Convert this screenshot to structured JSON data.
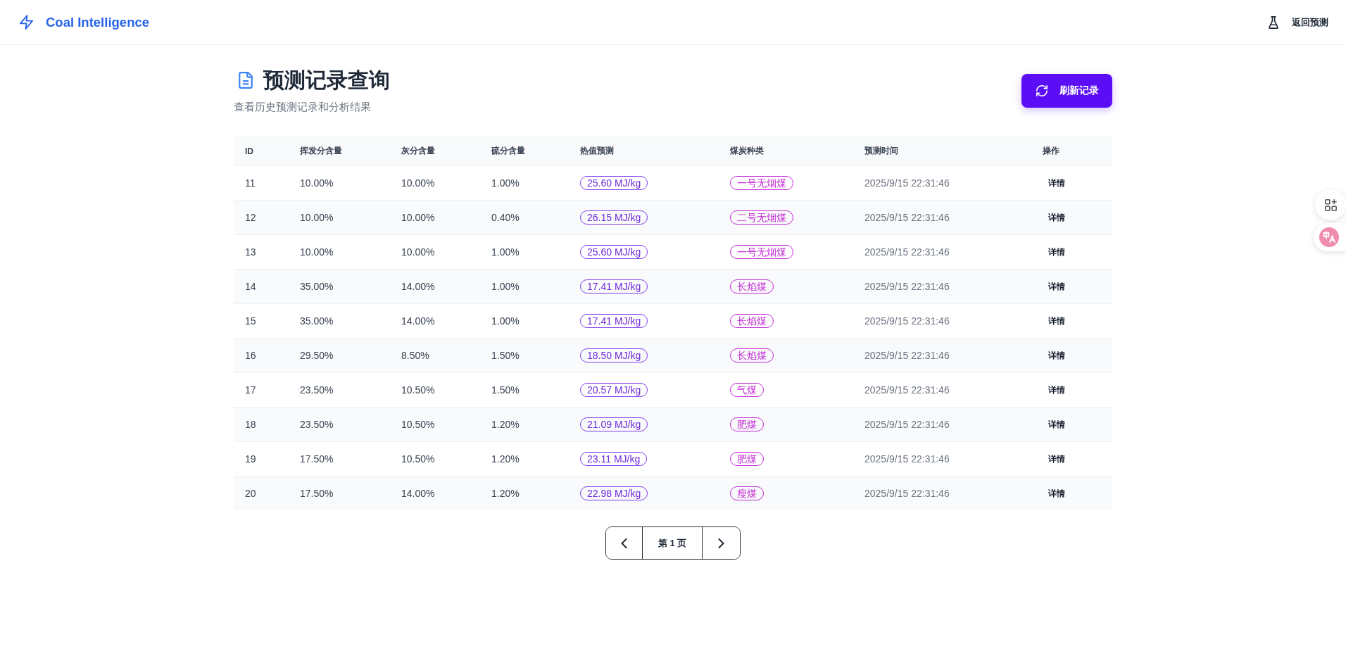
{
  "header": {
    "brand": "Coal Intelligence",
    "nav_link": "返回预测"
  },
  "page": {
    "title": "预测记录查询",
    "subtitle": "查看历史预测记录和分析结果",
    "refresh_button": "刷新记录"
  },
  "table": {
    "columns": [
      "ID",
      "挥发分含量",
      "灰分含量",
      "硫分含量",
      "热值预测",
      "煤炭种类",
      "预测时间",
      "操作"
    ],
    "rows": [
      {
        "id": "11",
        "volatile": "10.00%",
        "ash": "10.00%",
        "sulfur": "1.00%",
        "heat_value": "25.60 MJ/kg",
        "coal_type": "一号无烟煤",
        "time": "2025/9/15 22:31:46",
        "action": "详情"
      },
      {
        "id": "12",
        "volatile": "10.00%",
        "ash": "10.00%",
        "sulfur": "0.40%",
        "heat_value": "26.15 MJ/kg",
        "coal_type": "二号无烟煤",
        "time": "2025/9/15 22:31:46",
        "action": "详情"
      },
      {
        "id": "13",
        "volatile": "10.00%",
        "ash": "10.00%",
        "sulfur": "1.00%",
        "heat_value": "25.60 MJ/kg",
        "coal_type": "一号无烟煤",
        "time": "2025/9/15 22:31:46",
        "action": "详情"
      },
      {
        "id": "14",
        "volatile": "35.00%",
        "ash": "14.00%",
        "sulfur": "1.00%",
        "heat_value": "17.41 MJ/kg",
        "coal_type": "长焰煤",
        "time": "2025/9/15 22:31:46",
        "action": "详情"
      },
      {
        "id": "15",
        "volatile": "35.00%",
        "ash": "14.00%",
        "sulfur": "1.00%",
        "heat_value": "17.41 MJ/kg",
        "coal_type": "长焰煤",
        "time": "2025/9/15 22:31:46",
        "action": "详情"
      },
      {
        "id": "16",
        "volatile": "29.50%",
        "ash": "8.50%",
        "sulfur": "1.50%",
        "heat_value": "18.50 MJ/kg",
        "coal_type": "长焰煤",
        "time": "2025/9/15 22:31:46",
        "action": "详情"
      },
      {
        "id": "17",
        "volatile": "23.50%",
        "ash": "10.50%",
        "sulfur": "1.50%",
        "heat_value": "20.57 MJ/kg",
        "coal_type": "气煤",
        "time": "2025/9/15 22:31:46",
        "action": "详情"
      },
      {
        "id": "18",
        "volatile": "23.50%",
        "ash": "10.50%",
        "sulfur": "1.20%",
        "heat_value": "21.09 MJ/kg",
        "coal_type": "肥煤",
        "time": "2025/9/15 22:31:46",
        "action": "详情"
      },
      {
        "id": "19",
        "volatile": "17.50%",
        "ash": "10.50%",
        "sulfur": "1.20%",
        "heat_value": "23.11 MJ/kg",
        "coal_type": "肥煤",
        "time": "2025/9/15 22:31:46",
        "action": "详情"
      },
      {
        "id": "20",
        "volatile": "17.50%",
        "ash": "14.00%",
        "sulfur": "1.20%",
        "heat_value": "22.98 MJ/kg",
        "coal_type": "瘦煤",
        "time": "2025/9/15 22:31:46",
        "action": "详情"
      }
    ]
  },
  "pagination": {
    "page_label": "第 1 页"
  }
}
